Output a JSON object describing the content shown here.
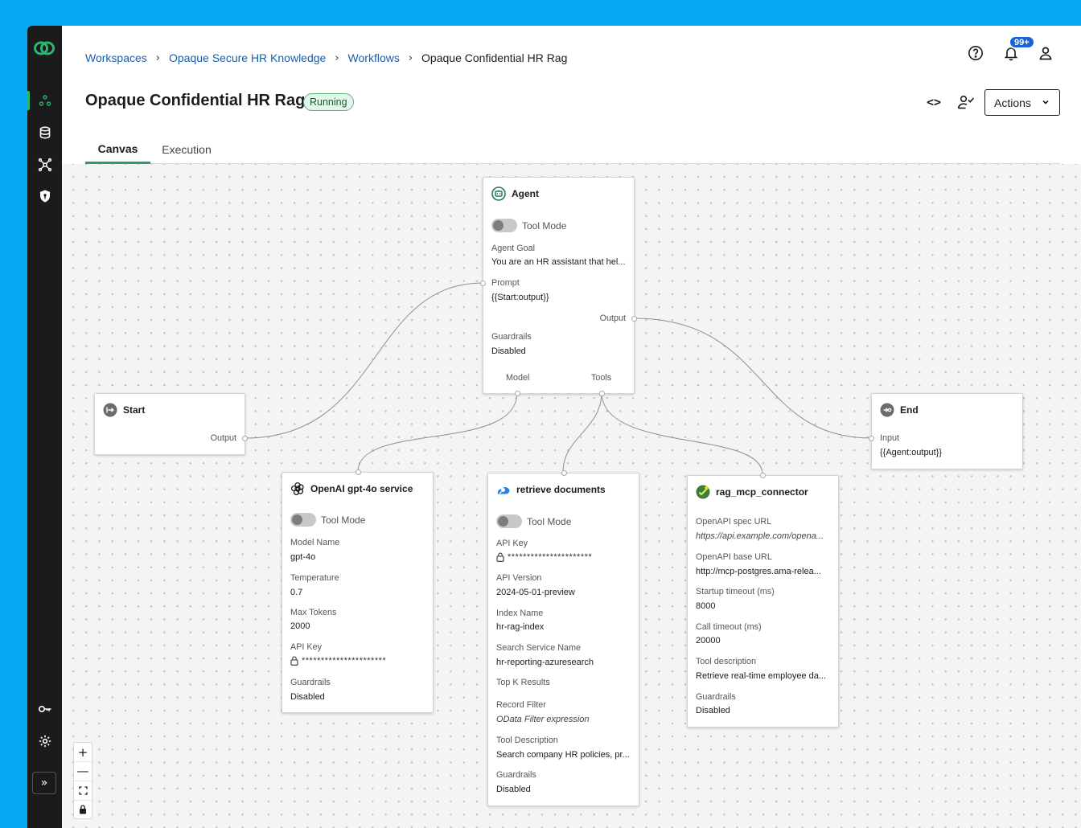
{
  "breadcrumb": {
    "items": [
      "Workspaces",
      "Opaque Secure HR Knowledge",
      "Workflows"
    ],
    "current": "Opaque Confidential HR Rag"
  },
  "header": {
    "title": "Opaque Confidential HR Rag",
    "status": "Running",
    "notification_count": "99+",
    "actions_label": "Actions"
  },
  "tabs": [
    {
      "label": "Canvas",
      "active": true
    },
    {
      "label": "Execution",
      "active": false
    }
  ],
  "sidebar": {
    "icons": [
      "workflow-icon",
      "database-icon",
      "network-icon",
      "shield-icon",
      "key-icon",
      "settings-icon"
    ],
    "collapse_glyph": "»"
  },
  "nodes": {
    "agent": {
      "title": "Agent",
      "tool_mode_label": "Tool Mode",
      "agent_goal_label": "Agent Goal",
      "agent_goal_value": "You are an HR assistant that hel...",
      "prompt_label": "Prompt",
      "prompt_value": "{{Start:output}}",
      "output_label": "Output",
      "guardrails_label": "Guardrails",
      "guardrails_value": "Disabled",
      "model_label": "Model",
      "tools_label": "Tools"
    },
    "start": {
      "title": "Start",
      "output_label": "Output"
    },
    "end": {
      "title": "End",
      "input_label": "Input",
      "input_value": "{{Agent:output}}"
    },
    "openai": {
      "title": "OpenAI gpt-4o service",
      "tool_mode_label": "Tool Mode",
      "model_name_label": "Model Name",
      "model_name_value": "gpt-4o",
      "temperature_label": "Temperature",
      "temperature_value": "0.7",
      "max_tokens_label": "Max Tokens",
      "max_tokens_value": "2000",
      "api_key_label": "API Key",
      "api_key_value": "**********************",
      "guardrails_label": "Guardrails",
      "guardrails_value": "Disabled"
    },
    "retrieve": {
      "title": "retrieve documents",
      "tool_mode_label": "Tool Mode",
      "api_key_label": "API Key",
      "api_key_value": "**********************",
      "api_version_label": "API Version",
      "api_version_value": "2024-05-01-preview",
      "index_name_label": "Index Name",
      "index_name_value": "hr-rag-index",
      "search_service_label": "Search Service Name",
      "search_service_value": "hr-reporting-azuresearch",
      "top_k_label": "Top K Results",
      "record_filter_label": "Record Filter",
      "record_filter_placeholder": "OData Filter expression",
      "tool_description_label": "Tool Description",
      "tool_description_value": "Search company HR policies, pr...",
      "guardrails_label": "Guardrails",
      "guardrails_value": "Disabled"
    },
    "mcp": {
      "title": "rag_mcp_connector",
      "spec_url_label": "OpenAPI spec URL",
      "spec_url_value": "https://api.example.com/opena...",
      "base_url_label": "OpenAPI base URL",
      "base_url_value": "http://mcp-postgres.ama-relea...",
      "startup_timeout_label": "Startup timeout (ms)",
      "startup_timeout_value": "8000",
      "call_timeout_label": "Call timeout (ms)",
      "call_timeout_value": "20000",
      "tool_description_label": "Tool description",
      "tool_description_value": "Retrieve real-time employee da...",
      "guardrails_label": "Guardrails",
      "guardrails_value": "Disabled"
    }
  },
  "zoom_controls": {
    "zoom_in": "+",
    "zoom_out": "—"
  },
  "colors": {
    "page_background": "#05a9f2",
    "sidebar": "#1b1b1b",
    "accent_green": "#2a9d63",
    "link_blue": "#1a5fa8",
    "badge_blue": "#1664d8"
  }
}
